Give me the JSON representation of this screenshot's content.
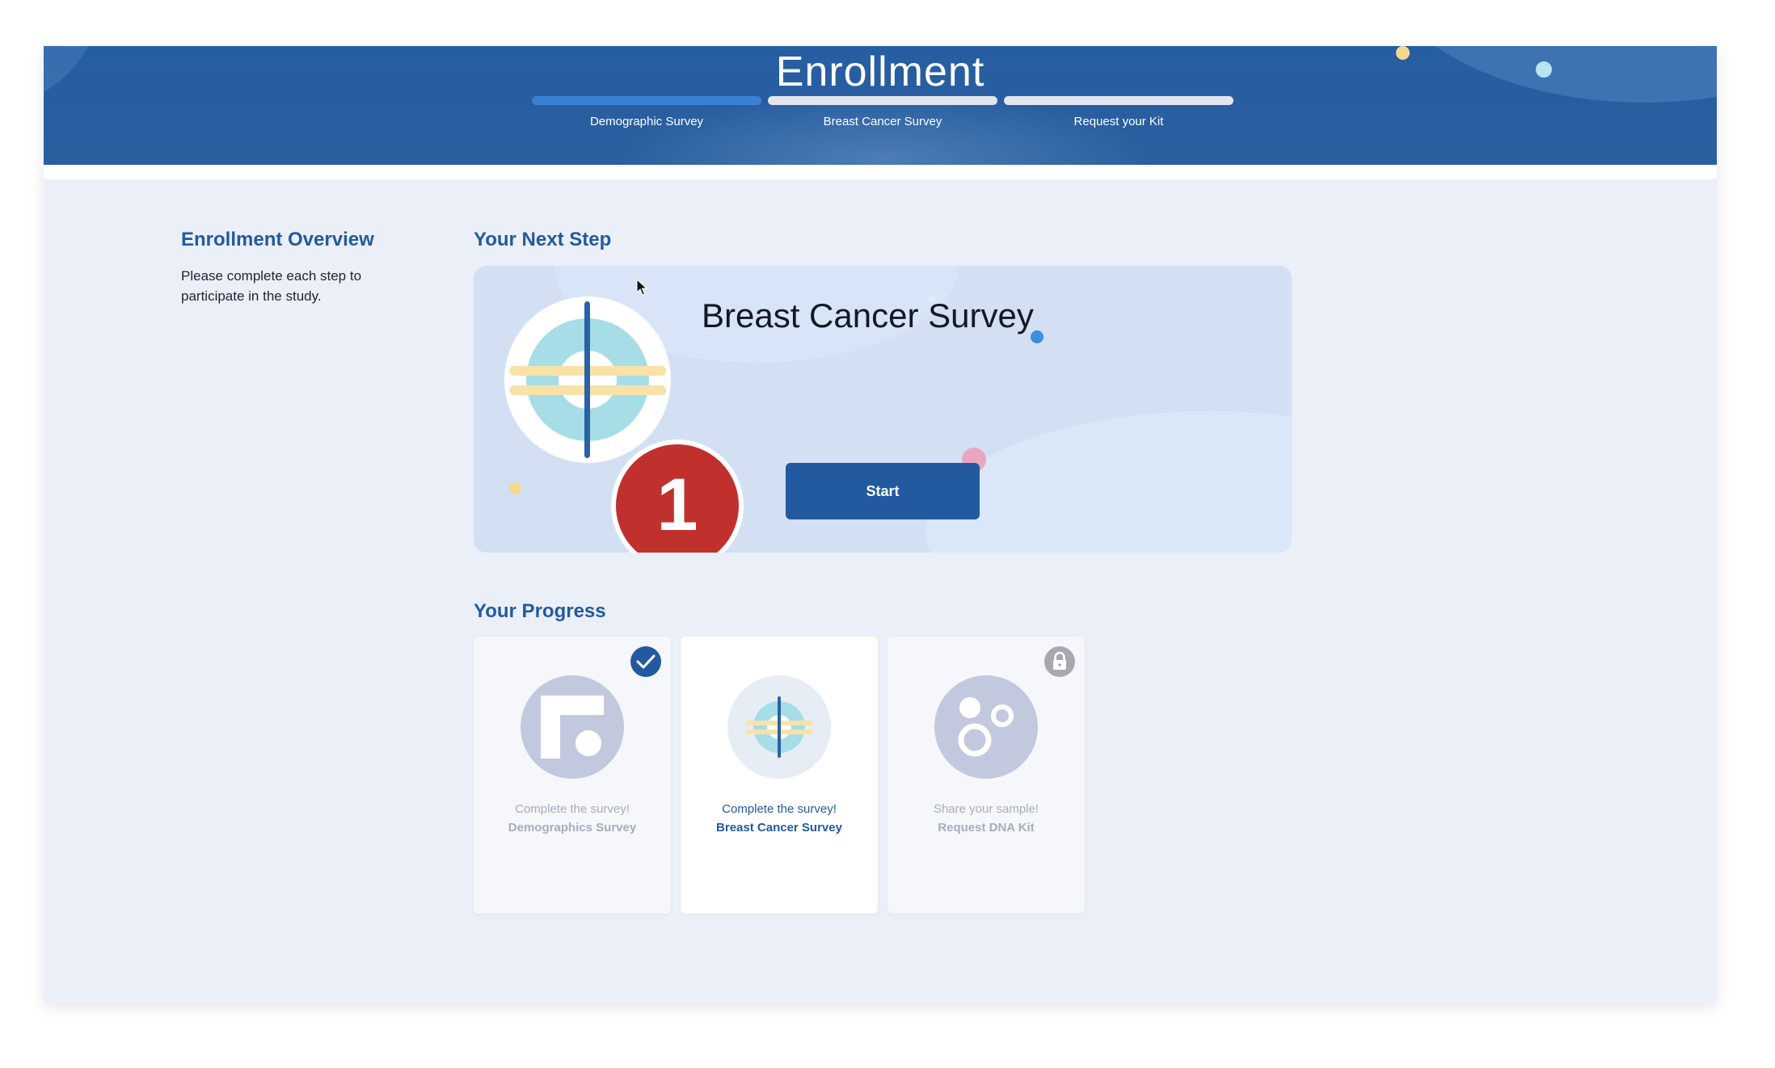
{
  "header": {
    "title": "Enrollment",
    "steps": [
      {
        "label": "Demographic Survey",
        "active": true
      },
      {
        "label": "Breast Cancer Survey",
        "active": false
      },
      {
        "label": "Request your Kit",
        "active": false
      }
    ]
  },
  "overview": {
    "title": "Enrollment Overview",
    "text": "Please complete each step to participate in the study."
  },
  "next_step": {
    "section_title": "Your Next Step",
    "title": "Breast Cancer Survey",
    "step_number": "1",
    "start_label": "Start"
  },
  "progress": {
    "section_title": "Your Progress",
    "cards": [
      {
        "line1": "Complete the survey!",
        "line2": "Demographics Survey",
        "status": "completed"
      },
      {
        "line1": "Complete the survey!",
        "line2": "Breast Cancer Survey",
        "status": "current"
      },
      {
        "line1": "Share your sample!",
        "line2": "Request DNA Kit",
        "status": "locked"
      }
    ]
  },
  "colors": {
    "primary": "#235a9f",
    "header_bg": "#275ea2",
    "active_step": "#3b80d2",
    "badge_red": "#c0312d",
    "card_bg": "#d3dff3",
    "page_bg": "#ebeff7"
  },
  "icons": [
    "target-survey-icon",
    "check-icon",
    "lock-icon",
    "demographics-icon",
    "dna-kit-icon",
    "cursor-icon"
  ]
}
